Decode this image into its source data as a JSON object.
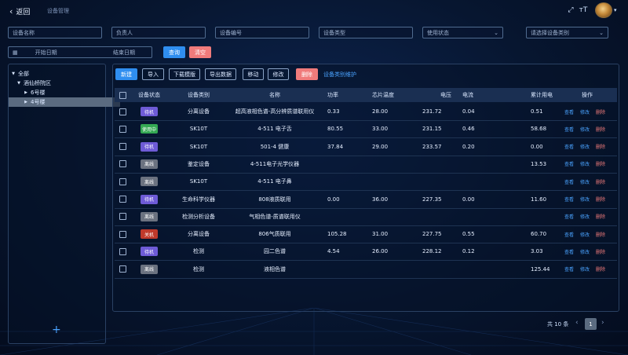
{
  "header": {
    "back_label": "返回",
    "breadcrumb": "设备管理"
  },
  "filters": {
    "device_name": "设备名称",
    "owner": "负责人",
    "device_code": "设备编号",
    "device_type": "设备类型",
    "usage_status": "使用状态",
    "device_category": "请选择设备类别",
    "start_date": "开始日期",
    "end_date": "结束日期",
    "search_label": "查询",
    "clear_label": "清空"
  },
  "tree": {
    "root": "全部",
    "campus": "酒仙桥院区",
    "building_6": "6号楼",
    "building_4": "4号楼"
  },
  "toolbar": {
    "new": "新建",
    "import": "导入",
    "download_template": "下载模版",
    "export": "导出数据",
    "move": "移动",
    "modify": "修改",
    "delete": "删除",
    "category_maintenance": "设备类别维护"
  },
  "table": {
    "columns": [
      "设备状态",
      "设备类别",
      "名称",
      "功率",
      "芯片温度",
      "电压",
      "电流",
      "累计用电",
      "操作"
    ],
    "rows": [
      {
        "status": "待机",
        "status_color": "#6e5bd6",
        "category": "分离设备",
        "name": "超高液相色谱-高分辨质谱联用仪",
        "power": "0.33",
        "temp": "28.00",
        "voltage": "231.72",
        "current": "0.04",
        "energy": "0.51"
      },
      {
        "status": "使用中",
        "status_color": "#34a853",
        "category": "SK10T",
        "name": "4-511 电子舌",
        "power": "80.55",
        "temp": "33.00",
        "voltage": "231.15",
        "current": "0.46",
        "energy": "58.68"
      },
      {
        "status": "待机",
        "status_color": "#6e5bd6",
        "category": "SK10T",
        "name": "501-4 健康",
        "power": "37.84",
        "temp": "29.00",
        "voltage": "233.57",
        "current": "0.20",
        "energy": "0.00"
      },
      {
        "status": "离线",
        "status_color": "#6b7280",
        "category": "鉴定设备",
        "name": "4-511电子光学仪器",
        "power": "",
        "temp": "",
        "voltage": "",
        "current": "",
        "energy": "13.53"
      },
      {
        "status": "离线",
        "status_color": "#6b7280",
        "category": "SK10T",
        "name": "4-511 电子鼻",
        "power": "",
        "temp": "",
        "voltage": "",
        "current": "",
        "energy": ""
      },
      {
        "status": "待机",
        "status_color": "#6e5bd6",
        "category": "生命科学仪器",
        "name": "808液质联用",
        "power": "0.00",
        "temp": "36.00",
        "voltage": "227.35",
        "current": "0.00",
        "energy": "11.60"
      },
      {
        "status": "离线",
        "status_color": "#6b7280",
        "category": "检测分析设备",
        "name": "气相色谱-质谱联用仪",
        "power": "",
        "temp": "",
        "voltage": "",
        "current": "",
        "energy": ""
      },
      {
        "status": "关机",
        "status_color": "#c0392b",
        "category": "分离设备",
        "name": "806气质联用",
        "power": "105.28",
        "temp": "31.00",
        "voltage": "227.75",
        "current": "0.55",
        "energy": "60.70"
      },
      {
        "status": "待机",
        "status_color": "#6e5bd6",
        "category": "检测",
        "name": "园二色谱",
        "power": "4.54",
        "temp": "26.00",
        "voltage": "228.12",
        "current": "0.12",
        "energy": "3.03"
      },
      {
        "status": "离线",
        "status_color": "#6b7280",
        "category": "检测",
        "name": "液相色谱",
        "power": "",
        "temp": "",
        "voltage": "",
        "current": "",
        "energy": "125.44"
      }
    ],
    "actions": {
      "view": "查看",
      "edit": "修改",
      "delete": "删除"
    }
  },
  "pagination": {
    "total": "共 10 条",
    "page": "1"
  },
  "colors": {
    "accent": "#2f8ef0",
    "danger": "#f07b7b",
    "standby": "#6e5bd6",
    "in_use": "#34a853",
    "offline": "#6b7280",
    "off": "#c0392b"
  }
}
